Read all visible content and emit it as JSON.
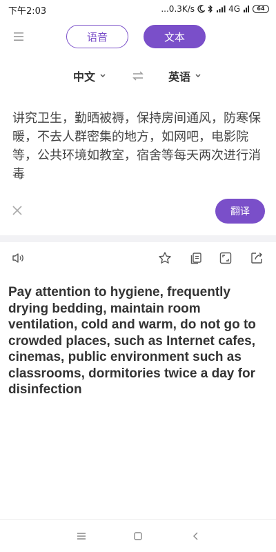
{
  "status_bar": {
    "time": "下午2:03",
    "speed": "...0.3K/s",
    "network": "4G",
    "battery": "64"
  },
  "mode_tabs": {
    "voice_label": "语音",
    "text_label": "文本",
    "active": "text"
  },
  "languages": {
    "source": "中文",
    "target": "英语"
  },
  "input": {
    "text": "讲究卫生，勤晒被褥，保持房间通风，防寒保暖，不去人群密集的地方，如网吧，电影院等，公共环境如教室，宿舍等每天两次进行消毒"
  },
  "actions": {
    "translate_label": "翻译"
  },
  "result": {
    "text": "Pay attention to hygiene, frequently drying bedding, maintain room ventilation, cold and warm, do not go to crowded places, such as Internet cafes, cinemas, public environment such as classrooms, dormitories twice a day for disinfection"
  },
  "colors": {
    "accent": "#7a4fc9",
    "divider": "#f2f2f5"
  }
}
